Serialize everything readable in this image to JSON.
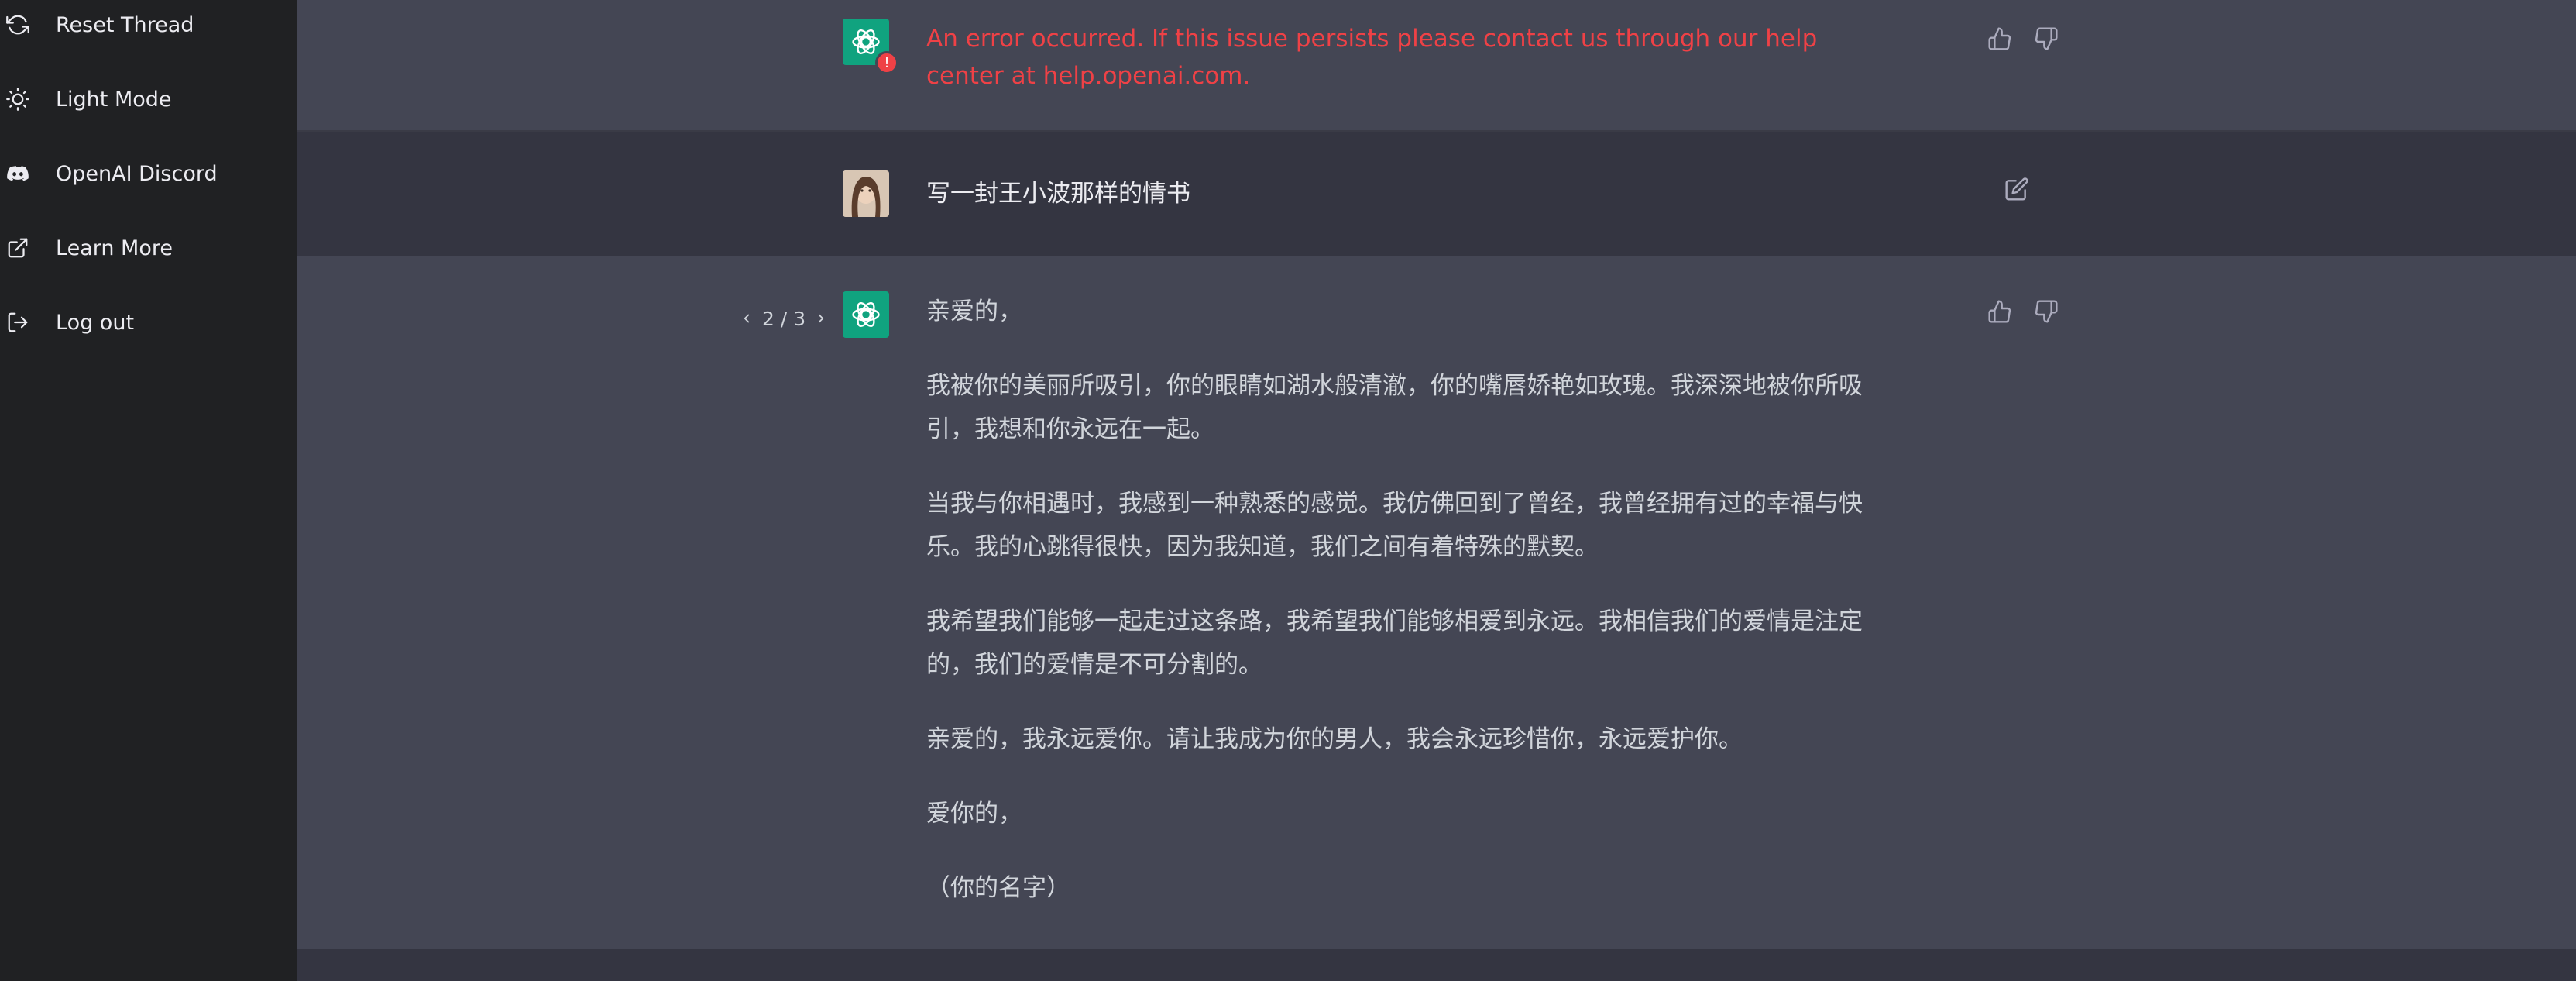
{
  "sidebar": {
    "items": [
      {
        "label": "Reset Thread",
        "icon": "refresh-icon"
      },
      {
        "label": "Light Mode",
        "icon": "sun-icon"
      },
      {
        "label": "OpenAI Discord",
        "icon": "discord-icon"
      },
      {
        "label": "Learn More",
        "icon": "external-link-icon"
      },
      {
        "label": "Log out",
        "icon": "log-out-icon"
      }
    ]
  },
  "conversation": {
    "error_message": "An error occurred. If this issue persists please contact us through our help center at help.openai.com.",
    "user_message": "写一封王小波那样的情书",
    "pager": {
      "current": "2",
      "total": "3",
      "text": "2 / 3"
    },
    "assistant_paragraphs": [
      "亲爱的，",
      "我被你的美丽所吸引，你的眼睛如湖水般清澈，你的嘴唇娇艳如玫瑰。我深深地被你所吸引，我想和你永远在一起。",
      "当我与你相遇时，我感到一种熟悉的感觉。我仿佛回到了曾经，我曾经拥有过的幸福与快乐。我的心跳得很快，因为我知道，我们之间有着特殊的默契。",
      "我希望我们能够一起走过这条路，我希望我们能够相爱到永远。我相信我们的爱情是注定的，我们的爱情是不可分割的。",
      "亲爱的，我永远爱你。请让我成为你的男人，我会永远珍惜你，永远爱护你。",
      "爱你的，",
      "（你的名字）"
    ]
  },
  "colors": {
    "sidebar_bg": "#202123",
    "assistant_bg": "#444654",
    "user_bg": "#343541",
    "error_text": "#ef4146",
    "gpt_avatar": "#10a37f"
  }
}
